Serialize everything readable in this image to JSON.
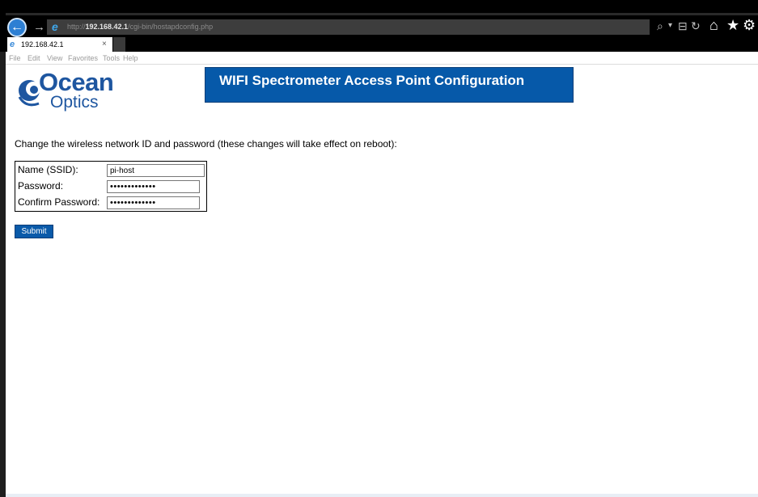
{
  "browser": {
    "url_prefix": "http://",
    "url_host": "192.168.42.1",
    "url_path": "/cgi-bin/hostapdconfig.php",
    "tab_title": "192.168.42.1",
    "tab_close": "×",
    "menu": [
      "File",
      "Edit",
      "View",
      "Favorites",
      "Tools",
      "Help"
    ],
    "icons": {
      "back": "←",
      "forward": "→",
      "search": "⌕",
      "dropdown": "▾",
      "compat": "⊟",
      "refresh": "↻",
      "home": "⌂",
      "favorites": "★",
      "settings": "⚙"
    }
  },
  "page": {
    "logo": {
      "line1": "Ocean",
      "line2": "Optics"
    },
    "banner_title": "WIFI Spectrometer Access Point Configuration",
    "instructions": "Change the wireless network ID and password (these changes will take effect on reboot):",
    "form": {
      "ssid_label": "Name (SSID):",
      "ssid_value": "pi-host",
      "password_label": "Password:",
      "password_value": "•••••••••••••",
      "confirm_label": "Confirm Password:",
      "confirm_value": "•••••••••••••"
    },
    "submit_label": "Submit"
  },
  "colors": {
    "banner": "#0659a9",
    "logo": "#1e56a0",
    "browser_chrome": "#000000"
  }
}
